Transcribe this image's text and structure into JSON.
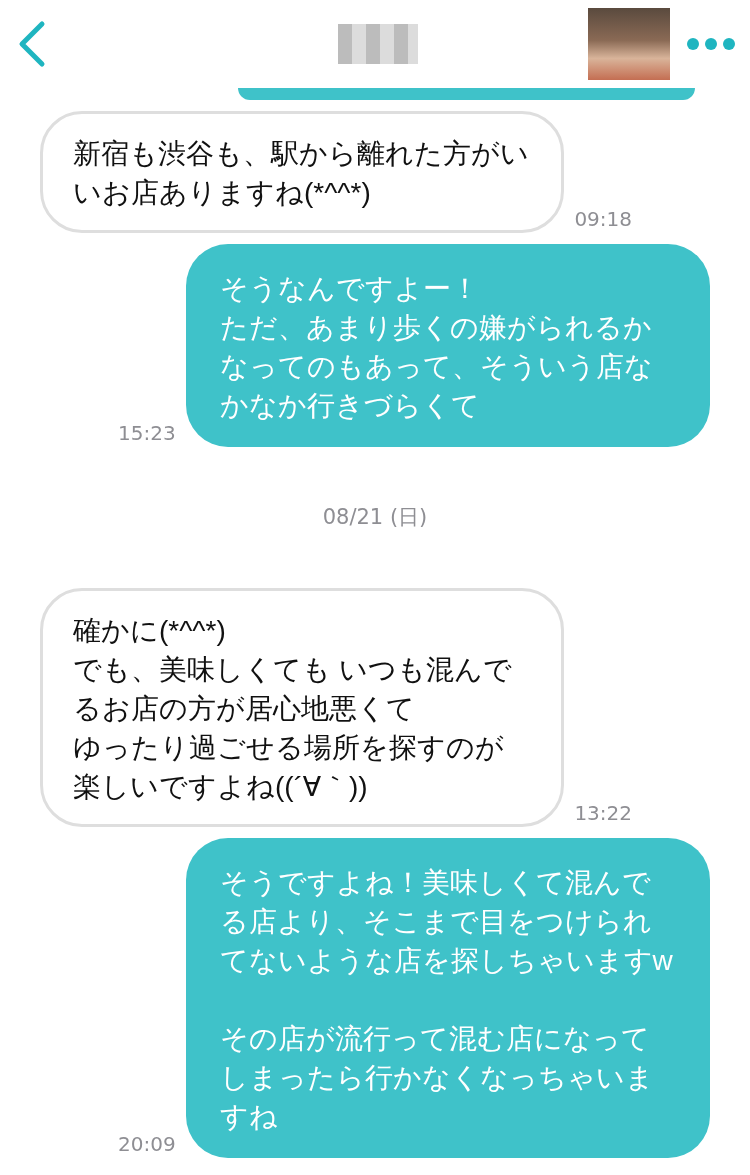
{
  "chat": [
    {
      "kind": "cutoff"
    },
    {
      "kind": "incoming",
      "paragraphs": [
        [
          "新宿も渋谷も、駅から離れた方がいいお店ありますね(*^^*)"
        ]
      ],
      "time": "09:18"
    },
    {
      "kind": "outgoing",
      "paragraphs": [
        [
          "そうなんですよー！",
          "ただ、あまり歩くの嫌がられるかなってのもあって、そういう店なかなか行きづらくて"
        ]
      ],
      "time": "15:23"
    },
    {
      "kind": "date",
      "label": "08/21 (日)"
    },
    {
      "kind": "incoming",
      "paragraphs": [
        [
          "確かに(*^^*)",
          "でも、美味しくても いつも混んでるお店の方が居心地悪くて",
          "ゆったり過ごせる場所を探すのが",
          "楽しいですよね((´∀｀))"
        ]
      ],
      "time": "13:22"
    },
    {
      "kind": "outgoing",
      "paragraphs": [
        [
          "そうですよね！美味しくて混んでる店より、そこまで目をつけられてないような店を探しちゃいますw"
        ],
        [
          "その店が流行って混む店になってしまったら行かなくなっちゃいますね"
        ]
      ],
      "time": "20:09"
    }
  ]
}
